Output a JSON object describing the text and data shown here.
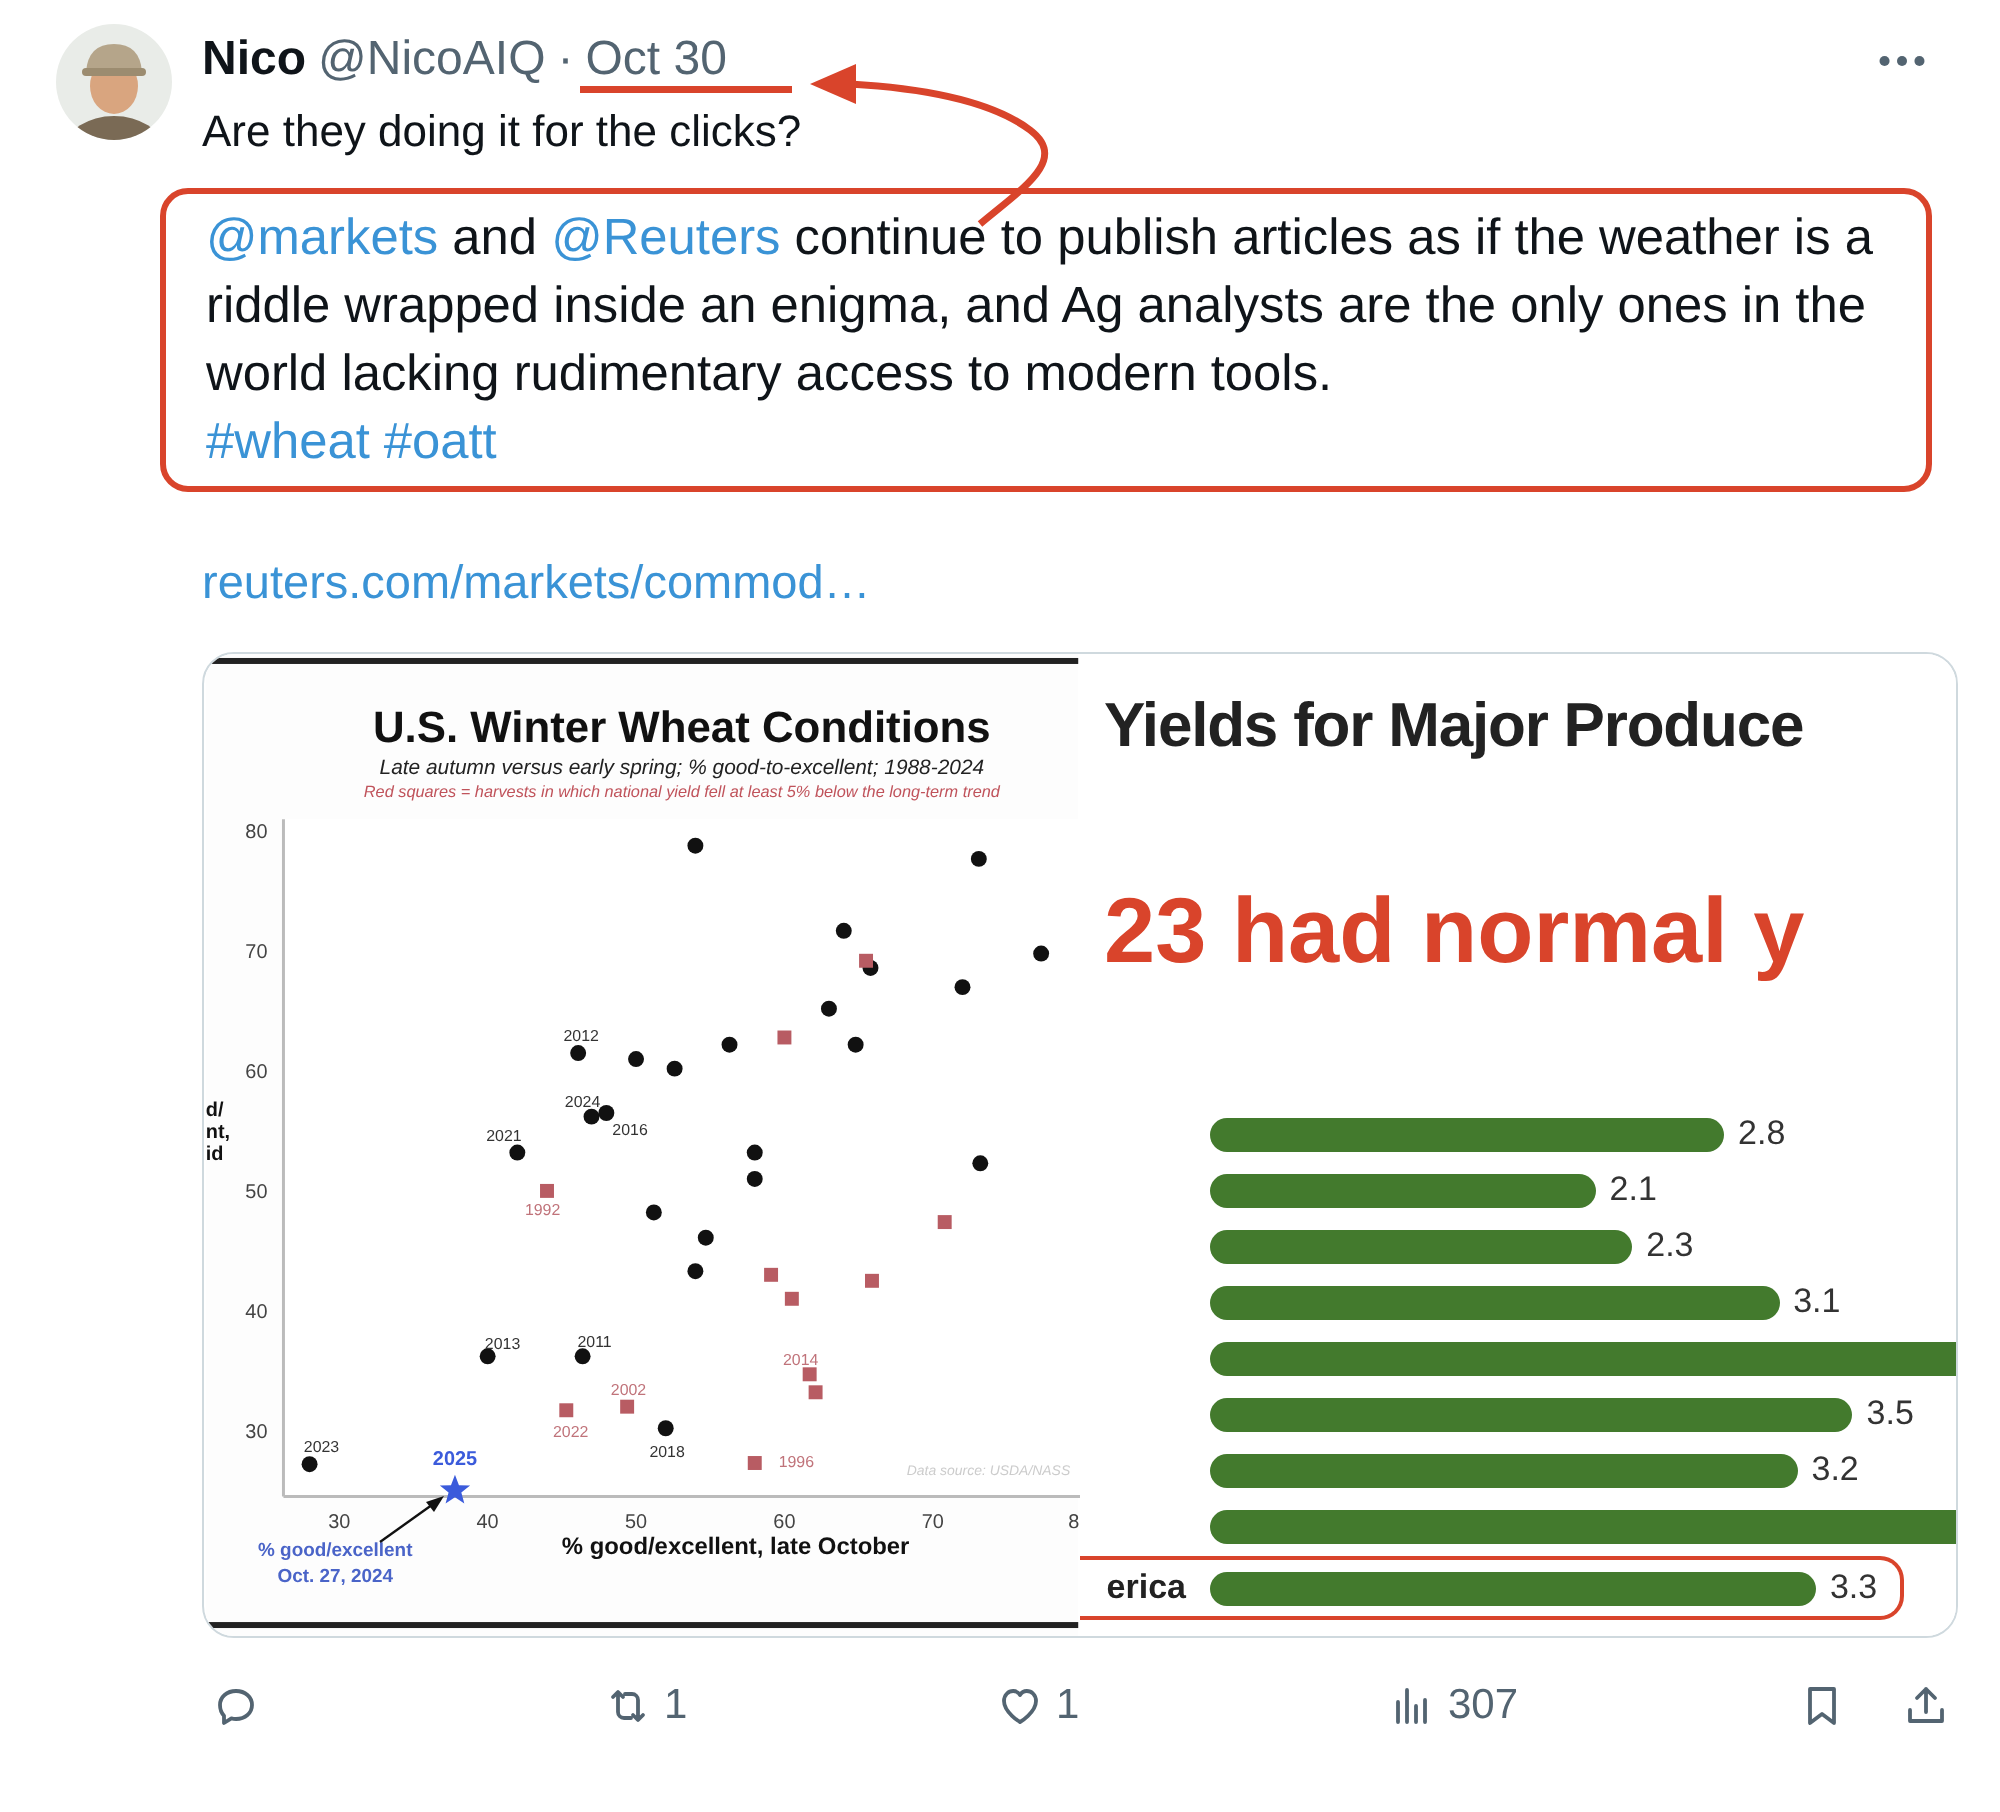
{
  "tweet": {
    "author": {
      "name": "Nico",
      "handle": "@NicoAIQ",
      "separator": "·",
      "date": "Oct 30"
    },
    "text": "Are they doing it for the clicks?",
    "quote": {
      "segments": [
        {
          "kind": "mention",
          "text": "@markets"
        },
        {
          "kind": "plain",
          "text": " and "
        },
        {
          "kind": "mention",
          "text": "@Reuters"
        },
        {
          "kind": "plain",
          "text": " continue to publish articles as if the weather is a riddle wrapped inside an enigma, and Ag analysts are the only ones in the world lacking rudimentary access to modern tools."
        }
      ],
      "hashtags": [
        "#wheat",
        "#oatt"
      ]
    },
    "link": "reuters.com/markets/commod…",
    "media": {
      "left": {
        "title": "U.S. Winter Wheat Conditions",
        "subtitle": "Late autumn versus early spring; % good-to-excellent; 1988-2024",
        "note": "Red squares = harvests in which national yield fell at least 5% below the long-term trend",
        "source": "Data source: USDA/NASS",
        "caption": [
          "% good/excellent",
          "Oct. 27, 2024"
        ],
        "cut_tick": "8",
        "chart_data": {
          "type": "scatter",
          "xlabel": "% good/excellent, late October",
          "ylabel": "d/\nnt,\nid",
          "xlim": [
            26.24,
            80
          ],
          "ylim": [
            24.5,
            81
          ],
          "xticks": [
            30,
            40,
            50,
            60,
            70
          ],
          "yticks": [
            30,
            40,
            50,
            60,
            70,
            80
          ],
          "x": [
            54,
            73.1,
            64,
            77.3,
            65.8,
            72,
            63,
            64.8,
            56.3,
            46.1,
            50,
            52.6,
            47,
            48,
            42,
            58,
            58,
            73.2,
            51.2,
            54.7,
            54,
            40,
            46.4,
            52,
            28,
            44,
            60,
            65.5,
            59.1,
            60.5,
            65.9,
            70.8,
            61.7,
            62.1,
            45.3,
            49.4,
            58,
            37.8
          ],
          "series": [
            {
              "color": "#111111",
              "marker": "circle",
              "values": [
                78.8,
                77.7,
                71.7,
                69.8,
                68.6,
                67,
                65.2,
                62.2,
                62.2,
                61.5,
                61,
                60.2,
                56.2,
                56.5,
                53.2,
                53.2,
                51,
                52.3,
                48.2,
                46.1,
                43.3,
                36.2,
                36.2,
                30.2,
                27.2,
                null,
                null,
                null,
                null,
                null,
                null,
                null,
                null,
                null,
                null,
                null,
                null,
                null
              ]
            },
            {
              "color": "#b85c63",
              "marker": "square",
              "values": [
                null,
                null,
                null,
                null,
                null,
                null,
                null,
                null,
                null,
                null,
                null,
                null,
                null,
                null,
                null,
                null,
                null,
                null,
                null,
                null,
                null,
                null,
                null,
                null,
                null,
                50,
                62.8,
                69.2,
                43,
                41,
                42.5,
                47.4,
                34.7,
                33.2,
                31.7,
                32,
                27.3,
                null
              ]
            },
            {
              "color": "#3b5bdb",
              "marker": "star",
              "values": [
                null,
                null,
                null,
                null,
                null,
                null,
                null,
                null,
                null,
                null,
                null,
                null,
                null,
                null,
                null,
                null,
                null,
                null,
                null,
                null,
                null,
                null,
                null,
                null,
                null,
                null,
                null,
                null,
                null,
                null,
                null,
                null,
                null,
                null,
                null,
                null,
                null,
                25
              ]
            }
          ],
          "annotations": [
            {
              "x": 46.1,
              "y": 61.5,
              "text": "2012"
            },
            {
              "x": 47,
              "y": 56.2,
              "text": "2024"
            },
            {
              "x": 48,
              "y": 56.5,
              "text": "2016"
            },
            {
              "x": 42,
              "y": 53.2,
              "text": "2021"
            },
            {
              "x": 44,
              "y": 50,
              "text": "1992"
            },
            {
              "x": 40,
              "y": 36.2,
              "text": "2013"
            },
            {
              "x": 46.4,
              "y": 36.2,
              "text": "2011"
            },
            {
              "x": 49.4,
              "y": 32,
              "text": "2002"
            },
            {
              "x": 45.3,
              "y": 31.7,
              "text": "2022"
            },
            {
              "x": 52,
              "y": 30.2,
              "text": "2018"
            },
            {
              "x": 28,
              "y": 27.2,
              "text": "2023"
            },
            {
              "x": 61.7,
              "y": 34.7,
              "text": "2014"
            },
            {
              "x": 58,
              "y": 27.3,
              "text": "1996"
            },
            {
              "x": 37.8,
              "y": 25,
              "text": "2025"
            }
          ]
        }
      },
      "right": {
        "title": "Yields for Major Produce",
        "headline": "23 had normal y",
        "bars": [
          {
            "reading": "2.8",
            "highlighted": false
          },
          {
            "reading": "2.1",
            "highlighted": false
          },
          {
            "reading": "2.3",
            "highlighted": false
          },
          {
            "reading": "3.1",
            "highlighted": false
          },
          {
            "highlighted": false
          },
          {
            "reading": "3.5",
            "highlighted": false
          },
          {
            "reading": "3.2",
            "highlighted": false
          },
          {
            "highlighted": false
          },
          {
            "reading": "3.3",
            "label": "erica",
            "highlighted": true
          }
        ]
      }
    },
    "actions": [
      {
        "kind": "reply"
      },
      {
        "kind": "retweet",
        "count": "1"
      },
      {
        "kind": "like",
        "count": "1"
      },
      {
        "kind": "views",
        "count": "307"
      },
      {
        "kind": "bookmark"
      },
      {
        "kind": "share"
      }
    ]
  }
}
